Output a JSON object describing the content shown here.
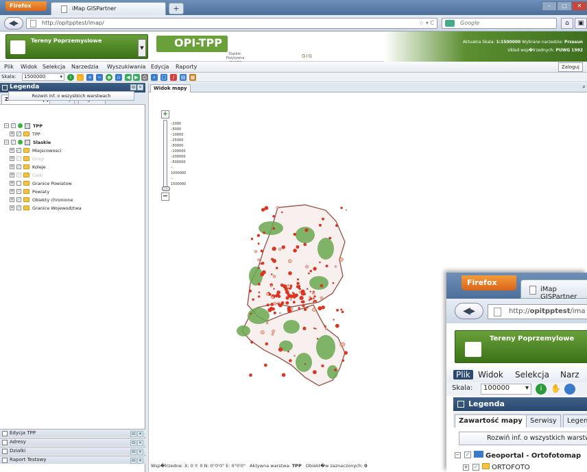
{
  "browser": {
    "brand": "Firefox",
    "tab_title": "iMap GISPartner",
    "new_tab": "+",
    "url_prefix": "http://",
    "url_host": "opitpptest",
    "url_path": "/imap/",
    "search_placeholder": "Google",
    "window_controls": [
      "–",
      "□",
      "✕"
    ]
  },
  "banner": {
    "project_name": "Tereny Poprzemyslowe",
    "logo_text": "OPI-TPP",
    "partner_text": "Śląskie. Pozytywna energia",
    "gig_text": "GIG",
    "scale_info_label": "Aktualna Skala:",
    "scale_info_value": "1:1500000",
    "tool_info_label": "Wybrane narzedzie:",
    "tool_info_value": "Przesun",
    "coord_label": "Układ wsp�łrzednych:",
    "coord_value": "PUWG 1992"
  },
  "menu": {
    "items": [
      "Plik",
      "Widok",
      "Selekcja",
      "Narzedzia",
      "Wyszukiwania",
      "Edycja",
      "Raporty"
    ],
    "login": "Zaloguj"
  },
  "toolbar": {
    "scale_label": "Skala:",
    "scale_value": "1500000"
  },
  "legend_panel": {
    "title": "Legenda",
    "tabs": [
      "Zawartość mapy",
      "Serwisy",
      "Legenda"
    ],
    "expand_button": "Rozwiń inf. o wszystkich warstwach",
    "tree": [
      {
        "label": "TPP",
        "level": 0,
        "bold": true,
        "type": "group-green"
      },
      {
        "label": "TPP",
        "level": 1,
        "bold": false,
        "type": "folder"
      },
      {
        "label": "Slaskie",
        "level": 0,
        "bold": true,
        "type": "group-service"
      },
      {
        "label": "Miejscowosci",
        "level": 1,
        "type": "folder"
      },
      {
        "label": "Drogi",
        "level": 1,
        "type": "folder",
        "dim": true
      },
      {
        "label": "Koleje",
        "level": 1,
        "type": "folder"
      },
      {
        "label": "Cieki",
        "level": 1,
        "type": "folder",
        "dim": true
      },
      {
        "label": "Granice Powiatow",
        "level": 1,
        "type": "folder"
      },
      {
        "label": "Powiaty",
        "level": 1,
        "type": "folder"
      },
      {
        "label": "Obiekty chronione",
        "level": 1,
        "type": "folder"
      },
      {
        "label": "Granice Wojewodztwa",
        "level": 1,
        "type": "folder"
      }
    ]
  },
  "bottom_panels": [
    "Edycja TPP",
    "Adresy",
    "Dzialki",
    "Raport Testowy"
  ],
  "map_panel": {
    "tab": "Widok mapy",
    "zoom_in": "+",
    "zoom_out": "−",
    "zoom_levels": [
      "2000",
      "5000",
      "10000",
      "25000",
      "50000",
      "100000",
      "200000",
      "500000",
      "1000000",
      "1500000"
    ],
    "status": {
      "coords_label": "Wsp�lrzedne:",
      "x": "X: 0",
      "y": "Y: 0",
      "n": "N: 0°0'0\"",
      "e": "E: 0°0'0\"",
      "active_layer_label": "Aktywna warstwa:",
      "active_layer": "TPP",
      "selected_label": "Obiekt�w zaznaczonych:",
      "selected_count": "0"
    }
  },
  "overlay": {
    "brand": "Firefox",
    "tab_title": "iMap GISPartner",
    "url_prefix": "http://",
    "url_host": "opitpptest",
    "url_path": "/ima",
    "project_name": "Tereny Poprzemylowe",
    "menu": [
      "Plik",
      "Widok",
      "Selekcja",
      "Narz"
    ],
    "scale_label": "Skala:",
    "scale_value": "100000",
    "legend_title": "Legenda",
    "tabs": [
      "Zawartość mapy",
      "Serwisy",
      "Legen"
    ],
    "expand_button": "Rozwiń inf. o wszystkich warstw",
    "rows": [
      "Geoportal - Ortofotomap",
      "ORTOFOTO"
    ]
  },
  "colors": {
    "header_blue": "#2b4970",
    "brand_green": "#3a7318",
    "firefox_orange": "#e8782a",
    "map_green": "#6aa84f",
    "map_red": "#e8321e",
    "border_brown": "#8c4a3c"
  }
}
